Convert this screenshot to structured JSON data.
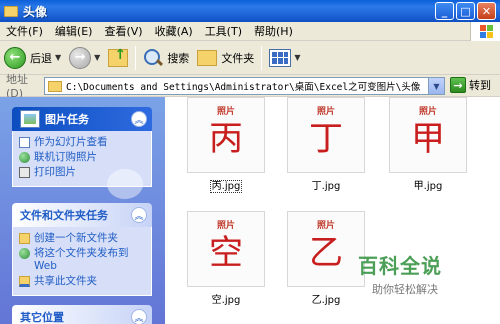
{
  "window": {
    "title": "头像"
  },
  "menu": [
    "文件(F)",
    "编辑(E)",
    "查看(V)",
    "收藏(A)",
    "工具(T)",
    "帮助(H)"
  ],
  "toolbar": {
    "back": "后退",
    "search": "搜索",
    "folders": "文件夹"
  },
  "address": {
    "label": "地址(D)",
    "path": "C:\\Documents and Settings\\Administrator\\桌面\\Excel之可变图片\\头像",
    "go": "转到"
  },
  "tasks": {
    "picture": {
      "title": "图片任务",
      "items": [
        "作为幻灯片查看",
        "联机订购照片",
        "打印图片"
      ]
    },
    "file": {
      "title": "文件和文件夹任务",
      "items": [
        "创建一个新文件夹",
        "将这个文件夹发布到 Web",
        "共享此文件夹"
      ]
    },
    "other": {
      "title": "其它位置"
    }
  },
  "files": [
    {
      "char": "丙",
      "caption": "照片",
      "name": "丙.jpg"
    },
    {
      "char": "丁",
      "caption": "照片",
      "name": "丁.jpg"
    },
    {
      "char": "甲",
      "caption": "照片",
      "name": "甲.jpg"
    },
    {
      "char": "空",
      "caption": "照片",
      "name": "空.jpg"
    },
    {
      "char": "乙",
      "caption": "照片",
      "name": "乙.jpg"
    }
  ],
  "watermark": {
    "main": "百科全说",
    "sub": "助你轻松解决"
  },
  "colors": {
    "titlebar": "#1e63d6",
    "taskpane": "#6f8fe0",
    "thumb_text": "#c81e1e"
  }
}
